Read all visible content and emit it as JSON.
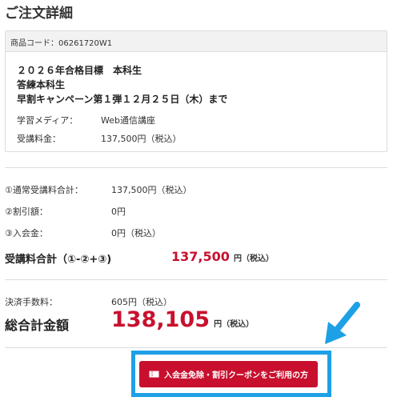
{
  "page": {
    "title": "ご注文詳細"
  },
  "product": {
    "code": "商品コード：06261720W1",
    "line1": "２０２６年合格目標　本科生",
    "line2": "答練本科生",
    "line3": "早割キャンペーン第１弾１２月２５日（木）まで",
    "media_label": "学習メディア：",
    "media_value": "Web通信講座",
    "fee_label": "受講料金：",
    "fee_value": "137,500円（税込）"
  },
  "summary": {
    "normal_total_label": "①通常受講料合計：",
    "normal_total_value": "137,500円（税込）",
    "discount_label": "②割引額：",
    "discount_value": "0円",
    "entry_fee_label": "③入会金：",
    "entry_fee_value": "0円（税込）",
    "total_label": "受講料合計（①-②+③)",
    "total_amount": "137,500",
    "total_unit": "円（税込）"
  },
  "payment": {
    "fee_label": "決済手数料：",
    "fee_value": "605円（税込）",
    "grand_label": "総合計金額",
    "grand_amount": "138,105",
    "grand_unit": "円（税込）"
  },
  "coupon_button": {
    "label": "入会金免除・割引クーポンをご利用の方",
    "icon": "ticket-icon"
  },
  "colors": {
    "accent_red": "#c8102e",
    "highlight_blue": "#1ea0e6"
  }
}
